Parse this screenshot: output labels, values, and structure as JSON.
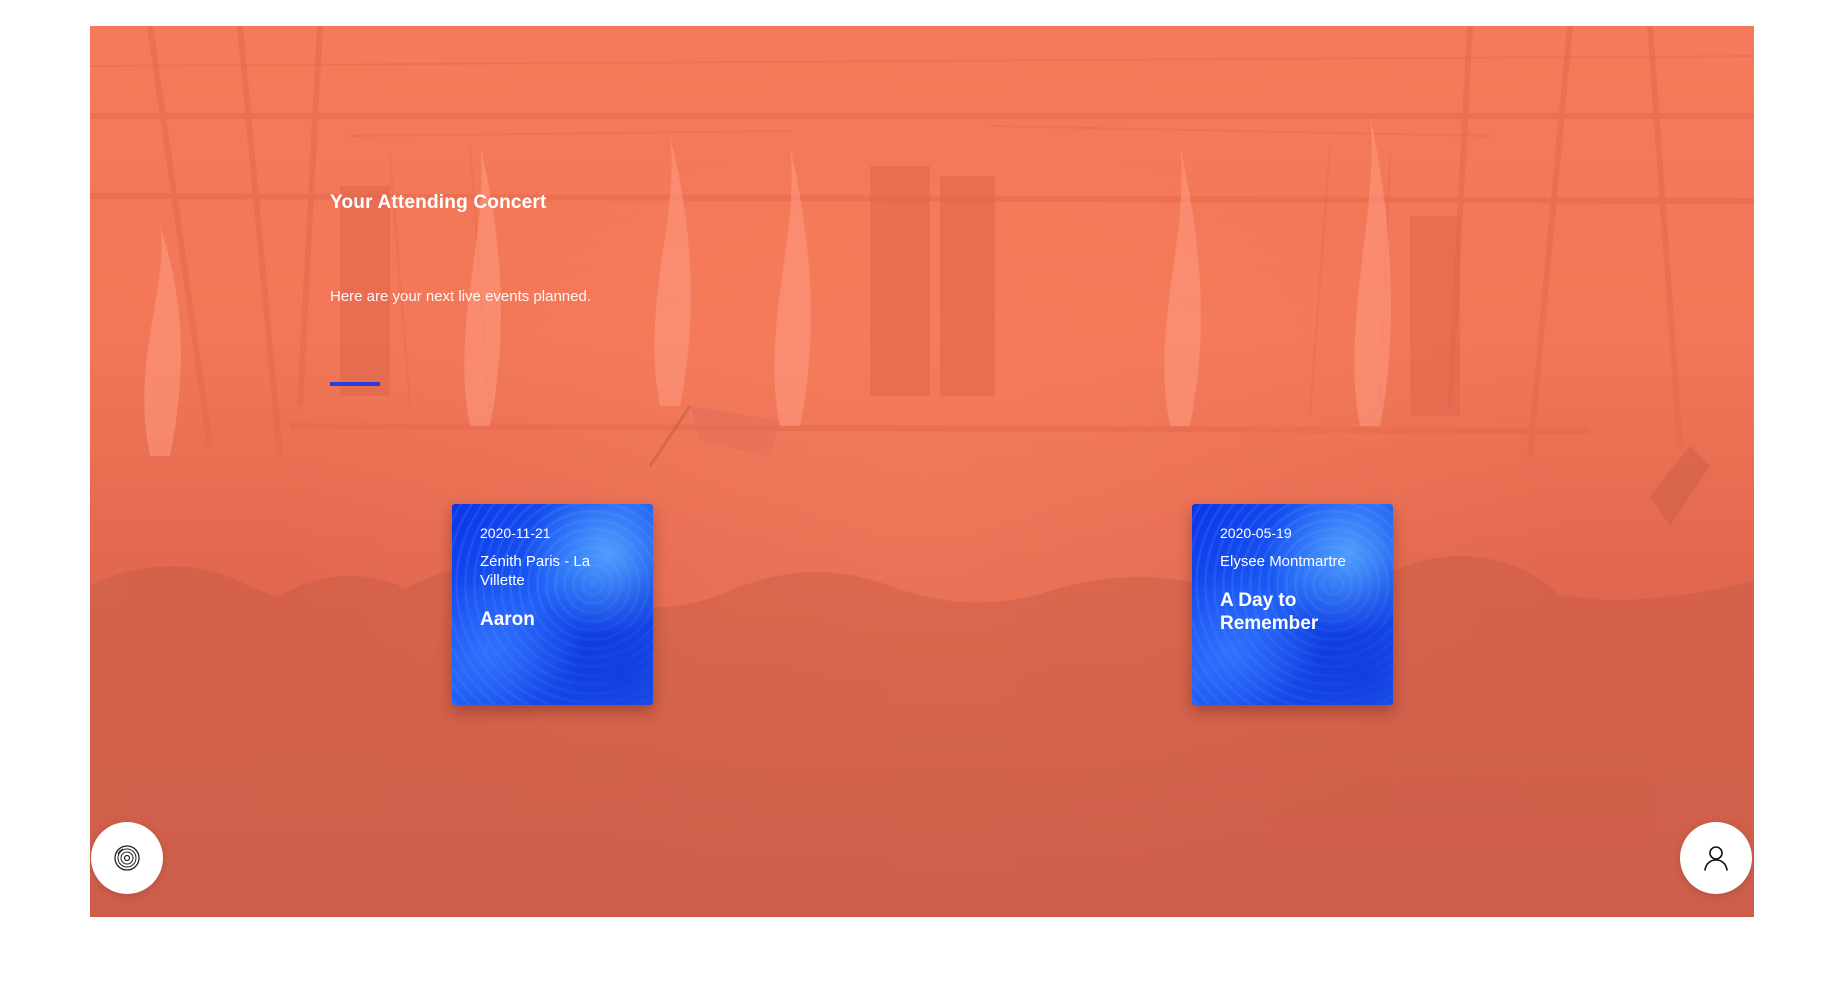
{
  "hero": {
    "title": "Your Attending Concert",
    "subtitle": "Here are your next live events planned.",
    "accent_color": "#2a3be0",
    "overlay_color": "#f27758"
  },
  "events": [
    {
      "date": "2020-11-21",
      "venue": "Zénith Paris - La Villette",
      "artist": "Aaron"
    },
    {
      "date": "2020-05-19",
      "venue": "Elysee Montmartre",
      "artist": "A Day to Remember"
    }
  ],
  "card_color": "#0b3fe6",
  "buttons": {
    "left_icon": "vinyl-record-icon",
    "right_icon": "user-profile-icon"
  }
}
